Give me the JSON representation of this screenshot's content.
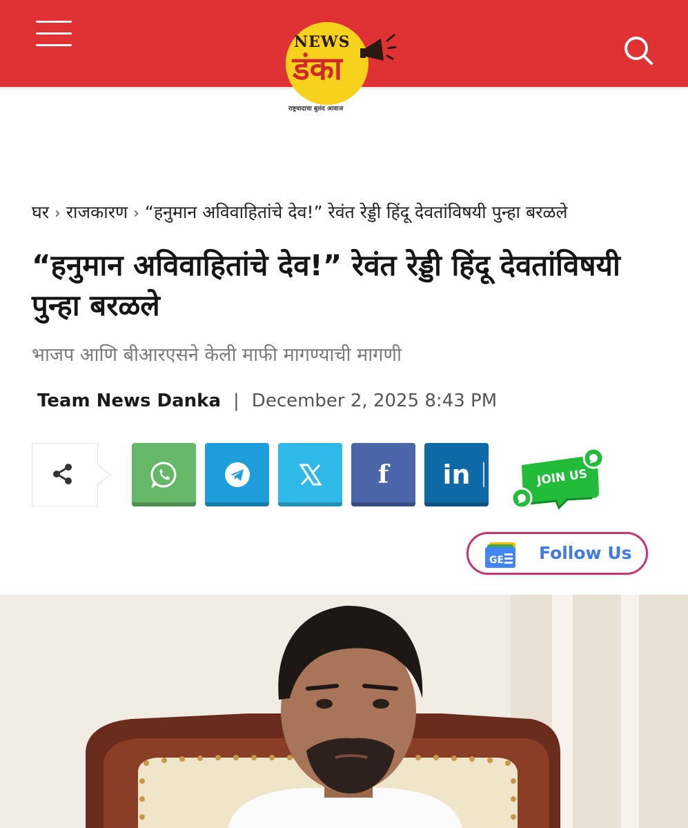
{
  "header": {
    "logo": {
      "top_text": "NEWS",
      "main_text": "डंका",
      "tagline": "राष्ट्रवादाचा बुलंद आवाज"
    },
    "menu_icon": "hamburger-menu-icon",
    "search_icon": "search-icon",
    "color": "#e03235"
  },
  "breadcrumb": {
    "items": [
      "घर",
      "राजकारण",
      "“हनुमान अविवाहितांचे देव!” रेवंत रेड्डी हिंदू देवतांविषयी पुन्हा बरळले"
    ],
    "separator": "›"
  },
  "article": {
    "title": "“हनुमान अविवाहितांचे देव!” रेवंत रेड्डी हिंदू देवतांविषयी पुन्हा बरळले",
    "subtitle": "भाजप आणि बीआरएसने केली माफी मागण्याची मागणी",
    "author": "Team News Danka",
    "separator": "|",
    "date": "December 2, 2025 8:43 PM"
  },
  "share": {
    "share_icon": "share-icon",
    "buttons": [
      {
        "name": "whatsapp",
        "icon": "whatsapp-icon",
        "color": "#64b867"
      },
      {
        "name": "telegram",
        "icon": "telegram-icon",
        "color": "#1e9fdc"
      },
      {
        "name": "x",
        "icon": "x-twitter-icon",
        "label": "𝕏",
        "color": "#2fb9e8"
      },
      {
        "name": "facebook",
        "icon": "facebook-icon",
        "label": "f",
        "color": "#4a65a8"
      },
      {
        "name": "linkedin",
        "icon": "linkedin-icon",
        "label": "in",
        "color": "#0d6aa7"
      }
    ],
    "join_label": "JOIN US"
  },
  "follow": {
    "label": "Follow Us",
    "icon_text": "GE",
    "icon": "google-news-icon"
  }
}
